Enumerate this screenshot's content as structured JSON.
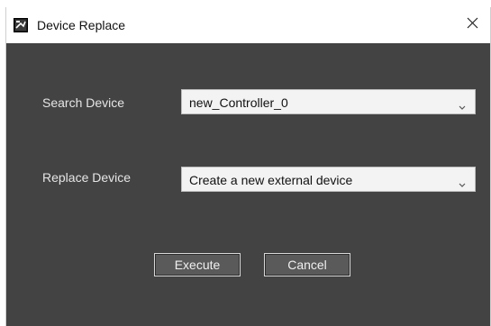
{
  "dialog": {
    "title": "Device Replace",
    "icon": "device-replace-app-icon",
    "close_icon": "close-icon"
  },
  "search_device": {
    "label": "Search Device",
    "selected": "new_Controller_0"
  },
  "replace_device": {
    "label": "Replace Device",
    "selected": "Create a new external device"
  },
  "buttons": {
    "execute": "Execute",
    "cancel": "Cancel"
  },
  "colors": {
    "dialog_background": "#434343",
    "button_background": "#5a5a5a",
    "dropdown_background": "#f3f3f3"
  }
}
